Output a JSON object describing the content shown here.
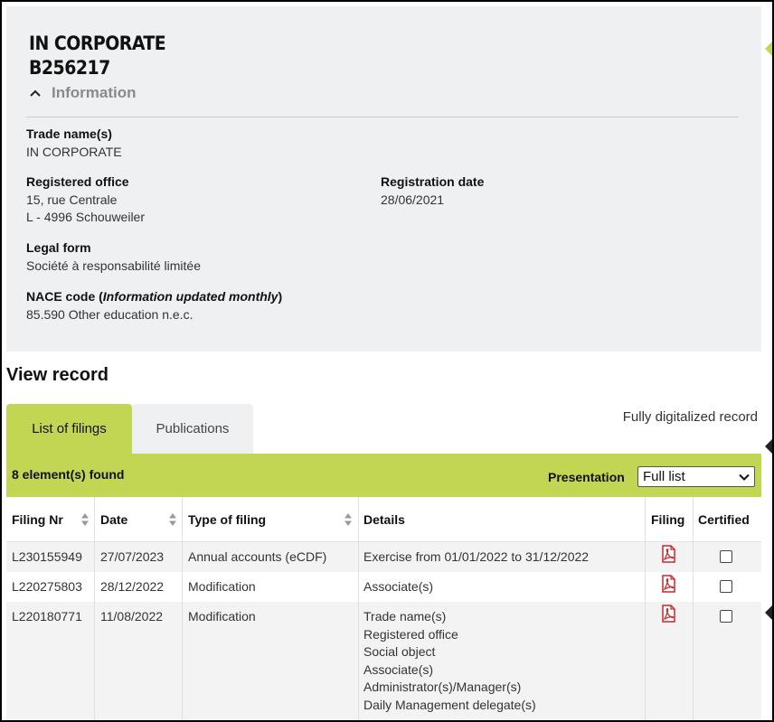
{
  "company": {
    "name": "IN CORPORATE",
    "id": "B256217"
  },
  "info_section": {
    "toggle_label": "Information",
    "trade_names_label": "Trade name(s)",
    "trade_names_value": "IN CORPORATE",
    "registered_office_label": "Registered office",
    "registered_office_line1": "15, rue Centrale",
    "registered_office_line2": "L - 4996 Schouweiler",
    "registration_date_label": "Registration date",
    "registration_date_value": "28/06/2021",
    "legal_form_label": "Legal form",
    "legal_form_value": "Société à responsabilité limitée",
    "nace_label": "NACE code (",
    "nace_label_italic": "Information updated monthly",
    "nace_label_end": ")",
    "nace_value": "85.590 Other education n.e.c."
  },
  "record": {
    "title": "View record",
    "tabs": [
      {
        "label": "List of filings",
        "active": true
      },
      {
        "label": "Publications",
        "active": false
      }
    ],
    "digital_note": "Fully digitalized record",
    "count_text": "8 element(s) found",
    "presentation_label": "Presentation",
    "presentation_value": "Full list"
  },
  "table": {
    "headers": {
      "filing_nr": "Filing Nr",
      "date": "Date",
      "type": "Type of filing",
      "details": "Details",
      "filing": "Filing",
      "certified": "Certified"
    },
    "rows": [
      {
        "filing_nr": "L230155949",
        "date": "27/07/2023",
        "type": "Annual accounts (eCDF)",
        "details": [
          "Exercise from 01/01/2022 to 31/12/2022"
        ]
      },
      {
        "filing_nr": "L220275803",
        "date": "28/12/2022",
        "type": "Modification",
        "details": [
          "Associate(s)"
        ]
      },
      {
        "filing_nr": "L220180771",
        "date": "11/08/2022",
        "type": "Modification",
        "details": [
          "Trade name(s)",
          "Registered office",
          "Social object",
          "Associate(s)",
          "Administrator(s)/Manager(s)",
          "Daily Management delegate(s)"
        ]
      }
    ]
  },
  "colors": {
    "accent_green": "#c3d654",
    "panel_gray": "#eef0f1",
    "pdf_red": "#d0242b"
  },
  "icons": {
    "toggle": "chevron-up-icon",
    "sort": "sort-icon",
    "pdf": "pdf-icon",
    "select": "chevron-down-icon"
  }
}
